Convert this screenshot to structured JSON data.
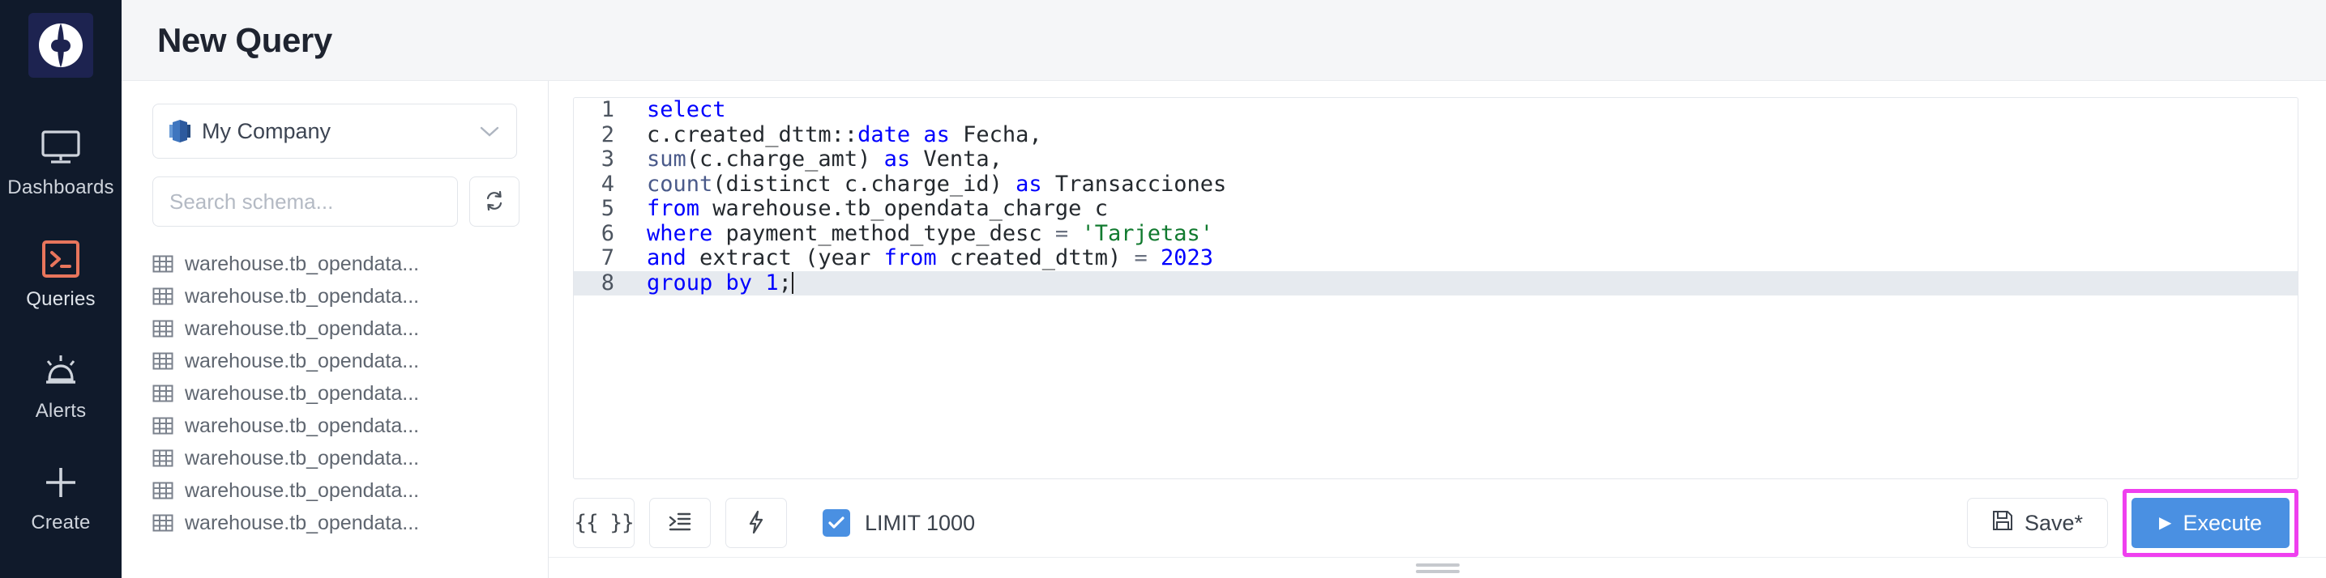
{
  "brand": {
    "logo_icon": "holistics-logo-icon",
    "logo_bg": "#1d2350",
    "rail_bg": "#101a2b",
    "active_accent": "#e8755c",
    "primary_blue": "#4a90e2",
    "highlight_magenta": "#ef3fef"
  },
  "sidebar": {
    "items": [
      {
        "label": "Dashboards",
        "icon": "monitor-icon",
        "active": false
      },
      {
        "label": "Queries",
        "icon": "terminal-icon",
        "active": true
      },
      {
        "label": "Alerts",
        "icon": "alarm-light-icon",
        "active": false
      },
      {
        "label": "Create",
        "icon": "plus-icon",
        "active": false
      }
    ]
  },
  "header": {
    "title": "New Query"
  },
  "schema_panel": {
    "datasource": {
      "label": "My Company",
      "icon": "redshift-icon",
      "chevron": "chevron-down-icon"
    },
    "search": {
      "placeholder": "Search schema...",
      "value": ""
    },
    "refresh_button": {
      "icon": "refresh-icon",
      "title": "Refresh schema"
    },
    "tables": [
      {
        "name": "warehouse.tb_opendata...",
        "icon": "table-icon"
      },
      {
        "name": "warehouse.tb_opendata...",
        "icon": "table-icon"
      },
      {
        "name": "warehouse.tb_opendata...",
        "icon": "table-icon"
      },
      {
        "name": "warehouse.tb_opendata...",
        "icon": "table-icon"
      },
      {
        "name": "warehouse.tb_opendata...",
        "icon": "table-icon"
      },
      {
        "name": "warehouse.tb_opendata...",
        "icon": "table-icon"
      },
      {
        "name": "warehouse.tb_opendata...",
        "icon": "table-icon"
      },
      {
        "name": "warehouse.tb_opendata...",
        "icon": "table-icon"
      },
      {
        "name": "warehouse.tb_opendata...",
        "icon": "table-icon"
      }
    ]
  },
  "editor": {
    "active_line": 8,
    "lines": [
      {
        "n": "1",
        "text": "select"
      },
      {
        "n": "2",
        "text": "c.created_dttm::date as Fecha,"
      },
      {
        "n": "3",
        "text": "sum(c.charge_amt) as Venta,"
      },
      {
        "n": "4",
        "text": "count(distinct c.charge_id) as Transacciones"
      },
      {
        "n": "5",
        "text": "from warehouse.tb_opendata_charge c"
      },
      {
        "n": "6",
        "text": "where payment_method_type_desc = 'Tarjetas'"
      },
      {
        "n": "7",
        "text": "and extract (year from created_dttm) = 2023"
      },
      {
        "n": "8",
        "text": "group by 1;"
      }
    ]
  },
  "toolbar": {
    "params_button": {
      "label": "{{ }}",
      "icon": "braces-icon"
    },
    "format_button": {
      "icon": "indent-format-icon"
    },
    "lightning_button": {
      "icon": "lightning-bolt-icon"
    },
    "limit": {
      "label": "LIMIT 1000",
      "checked": true
    },
    "save_button": {
      "label": "Save*",
      "icon": "floppy-disk-icon"
    },
    "execute_button": {
      "label": "Execute",
      "icon": "play-icon",
      "highlighted": true
    }
  },
  "resize_handle": {
    "icon": "drag-grip-icon"
  }
}
